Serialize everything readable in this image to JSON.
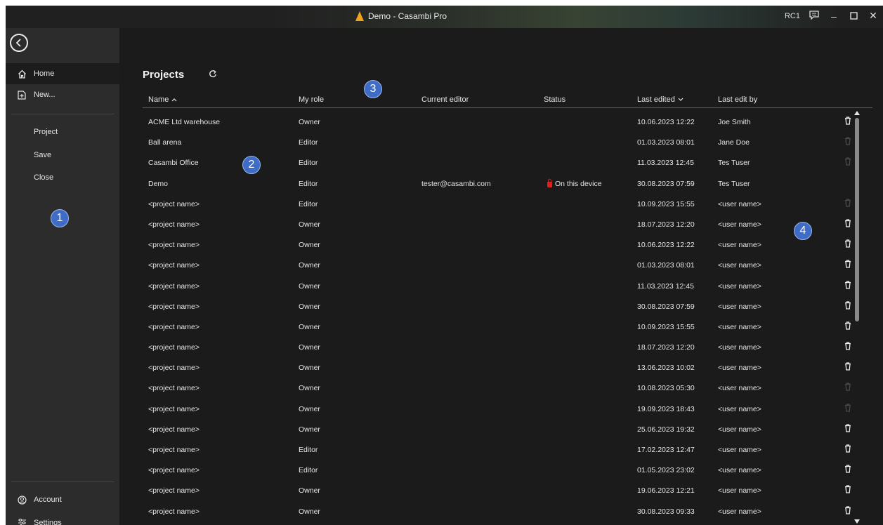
{
  "window": {
    "title": "Demo - Casambi Pro",
    "user_badge": "RC1",
    "accent": "#f3a21b"
  },
  "sidebar": {
    "home": "Home",
    "new": "New...",
    "project": "Project",
    "save": "Save",
    "close": "Close",
    "account": "Account",
    "settings": "Settings"
  },
  "main": {
    "title": "Projects",
    "columns": {
      "name": "Name",
      "role": "My role",
      "editor": "Current editor",
      "status": "Status",
      "edited": "Last edited",
      "by": "Last edit by"
    },
    "rows": [
      {
        "name": "ACME Ltd warehouse",
        "role": "Owner",
        "editor": "",
        "status": "",
        "edited": "10.06.2023 12:22",
        "by": "Joe Smith",
        "delete": "enabled"
      },
      {
        "name": "Ball arena",
        "role": "Editor",
        "editor": "",
        "status": "",
        "edited": "01.03.2023 08:01",
        "by": "Jane Doe",
        "delete": "disabled"
      },
      {
        "name": "Casambi Office",
        "role": "Editor",
        "editor": "",
        "status": "",
        "edited": "11.03.2023 12:45",
        "by": "Tes Tuser",
        "delete": "disabled"
      },
      {
        "name": "Demo",
        "role": "Editor",
        "editor": "tester@casambi.com",
        "status": "On this device",
        "edited": "30.08.2023 07:59",
        "by": "Tes Tuser",
        "delete": "none"
      },
      {
        "name": "<project name>",
        "role": "Editor",
        "editor": "",
        "status": "",
        "edited": "10.09.2023 15:55",
        "by": "<user name>",
        "delete": "disabled"
      },
      {
        "name": "<project name>",
        "role": "Owner",
        "editor": "",
        "status": "",
        "edited": "18.07.2023 12:20",
        "by": "<user name>",
        "delete": "enabled"
      },
      {
        "name": "<project name>",
        "role": "Owner",
        "editor": "",
        "status": "",
        "edited": "10.06.2023 12:22",
        "by": "<user name>",
        "delete": "enabled"
      },
      {
        "name": "<project name>",
        "role": "Owner",
        "editor": "",
        "status": "",
        "edited": "01.03.2023 08:01",
        "by": "<user name>",
        "delete": "enabled"
      },
      {
        "name": "<project name>",
        "role": "Owner",
        "editor": "",
        "status": "",
        "edited": "11.03.2023 12:45",
        "by": "<user name>",
        "delete": "enabled"
      },
      {
        "name": "<project name>",
        "role": "Owner",
        "editor": "",
        "status": "",
        "edited": "30.08.2023 07:59",
        "by": "<user name>",
        "delete": "enabled"
      },
      {
        "name": "<project name>",
        "role": "Owner",
        "editor": "",
        "status": "",
        "edited": "10.09.2023 15:55",
        "by": "<user name>",
        "delete": "enabled"
      },
      {
        "name": "<project name>",
        "role": "Owner",
        "editor": "",
        "status": "",
        "edited": "18.07.2023 12:20",
        "by": "<user name>",
        "delete": "enabled"
      },
      {
        "name": "<project name>",
        "role": "Owner",
        "editor": "",
        "status": "",
        "edited": "13.06.2023 10:02",
        "by": "<user name>",
        "delete": "enabled"
      },
      {
        "name": "<project name>",
        "role": "Owner",
        "editor": "",
        "status": "",
        "edited": "10.08.2023 05:30",
        "by": "<user name>",
        "delete": "disabled"
      },
      {
        "name": "<project name>",
        "role": "Owner",
        "editor": "",
        "status": "",
        "edited": "19.09.2023 18:43",
        "by": "<user name>",
        "delete": "disabled"
      },
      {
        "name": "<project name>",
        "role": "Owner",
        "editor": "",
        "status": "",
        "edited": "25.06.2023 19:32",
        "by": "<user name>",
        "delete": "enabled"
      },
      {
        "name": "<project name>",
        "role": "Editor",
        "editor": "",
        "status": "",
        "edited": "17.02.2023 12:47",
        "by": "<user name>",
        "delete": "enabled"
      },
      {
        "name": "<project name>",
        "role": "Editor",
        "editor": "",
        "status": "",
        "edited": "01.05.2023 23:02",
        "by": "<user name>",
        "delete": "enabled"
      },
      {
        "name": "<project name>",
        "role": "Owner",
        "editor": "",
        "status": "",
        "edited": "19.06.2023 12:21",
        "by": "<user name>",
        "delete": "enabled"
      },
      {
        "name": "<project name>",
        "role": "Owner",
        "editor": "",
        "status": "",
        "edited": "30.08.2023 09:33",
        "by": "<user name>",
        "delete": "enabled"
      }
    ]
  },
  "callouts": [
    "1",
    "2",
    "3",
    "4"
  ],
  "colors": {
    "callout": "#3f6cc6",
    "lock": "#e02020",
    "sidebar": "#2c2c2c",
    "background": "#1b1b1b"
  }
}
